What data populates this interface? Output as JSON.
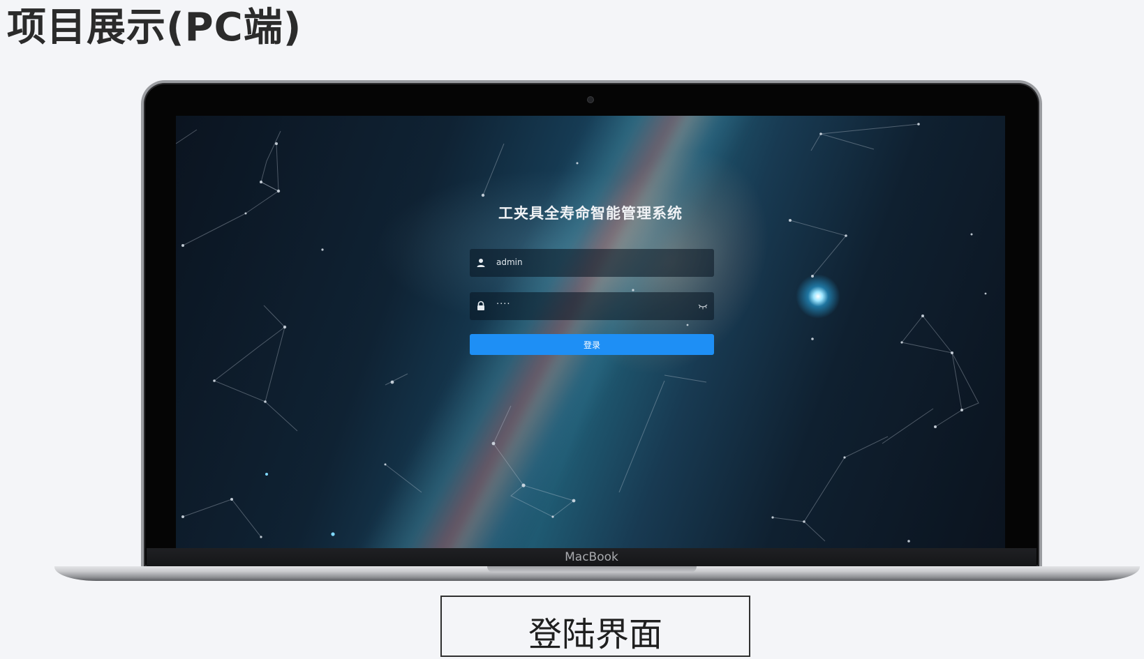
{
  "slide": {
    "title": "项目展示(PC端)",
    "caption": "登陆界面"
  },
  "laptop": {
    "brand": "MacBook"
  },
  "login": {
    "title": "工夹具全寿命智能管理系统",
    "username_value": "admin",
    "password_mask": "····",
    "submit_label": "登录",
    "user_icon": "user-icon",
    "lock_icon": "lock-icon",
    "toggle_icon": "eye-closed-icon"
  },
  "colors": {
    "page_background": "#f4f5f8",
    "login_button": "#1e8ff5",
    "screen_background": "#0f2233",
    "laptop_bezel": "#050505"
  }
}
